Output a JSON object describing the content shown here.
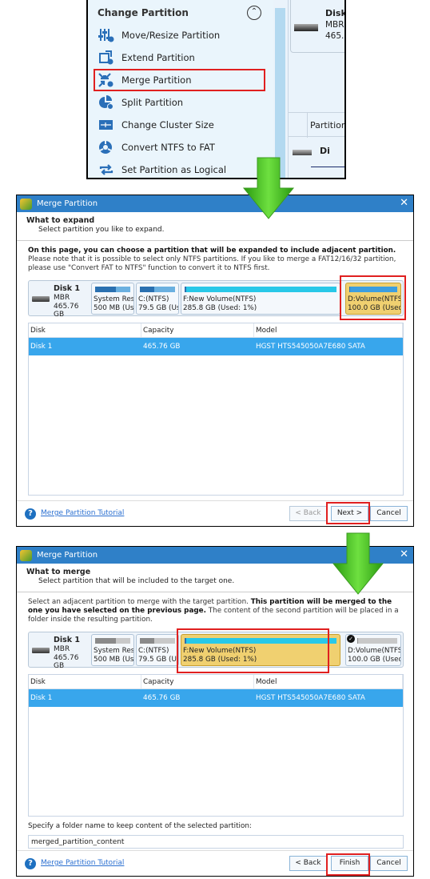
{
  "top_panel": {
    "group_title": "Change Partition",
    "collapse_icon": "chevron-up-circle-icon",
    "menu_items": [
      {
        "label": "Move/Resize Partition",
        "icon": "move-resize-icon"
      },
      {
        "label": "Extend Partition",
        "icon": "extend-icon"
      },
      {
        "label": "Merge Partition",
        "icon": "merge-icon",
        "highlighted": true
      },
      {
        "label": "Split Partition",
        "icon": "split-icon"
      },
      {
        "label": "Change Cluster Size",
        "icon": "cluster-icon"
      },
      {
        "label": "Convert NTFS to FAT",
        "icon": "convert-icon"
      },
      {
        "label": "Set Partition as Logical",
        "icon": "logical-icon"
      }
    ],
    "right_peek": {
      "disk_name": "Disk",
      "disk_type": "MBR",
      "disk_size": "465.",
      "column_header": "Partition",
      "disk_row": "Di"
    }
  },
  "dialog1": {
    "title": "Merge Partition",
    "header_title": "What to expand",
    "header_sub": "Select partition you like to expand.",
    "desc_bold": "On this page, you can choose a partition that will be expanded to include adjacent partition.",
    "desc_rest": " Please note that it is possible to select only NTFS partitions. If you like to merge a FAT12/16/32 partition, please use \"Convert FAT to NTFS\" function to convert it to NTFS first.",
    "disk": {
      "name": "Disk 1",
      "type": "MBR",
      "size": "465.76 GB"
    },
    "partitions": [
      {
        "l1": "System Rese",
        "l2": "500 MB (Use",
        "used": 0.6
      },
      {
        "l1": "C:(NTFS)",
        "l2": "79.5 GB (Us",
        "used": 0.4
      },
      {
        "l1": "F:New Volume(NTFS)",
        "l2": "285.8 GB (Used: 1%)",
        "used": 0.01
      },
      {
        "l1": "D:Volume(NTFS",
        "l2": "100.0 GB (Used",
        "used": 0.02,
        "selected": true
      }
    ],
    "table": {
      "headers": [
        "Disk",
        "Capacity",
        "Model"
      ],
      "rows": [
        [
          "Disk 1",
          "465.76 GB",
          "HGST HTS545050A7E680 SATA"
        ]
      ]
    },
    "tutorial_link": "Merge Partition Tutorial",
    "buttons": {
      "back": "< Back",
      "next": "Next >",
      "cancel": "Cancel"
    }
  },
  "dialog2": {
    "title": "Merge Partition",
    "header_title": "What to merge",
    "header_sub": "Select partition that will be included to the target one.",
    "desc_start": "Select an adjacent partition to merge with the target partition. ",
    "desc_bold": "This partition will be merged to the one you have selected on the previous page.",
    "desc_rest": " The content of the second partition will be placed in a folder inside the resulting partition.",
    "disk": {
      "name": "Disk 1",
      "type": "MBR",
      "size": "465.76 GB"
    },
    "partitions": [
      {
        "l1": "System Rese",
        "l2": "500 MB (Use",
        "used": 0.6
      },
      {
        "l1": "C:(NTFS)",
        "l2": "79.5 GB (Use",
        "used": 0.4
      },
      {
        "l1": "F:New Volume(NTFS)",
        "l2": "285.8 GB (Used: 1%)",
        "used": 0.01,
        "selected": true
      },
      {
        "l1": "D:Volume(NTFS",
        "l2": "100.0 GB (Used",
        "used": 0.02,
        "target": true
      }
    ],
    "table": {
      "headers": [
        "Disk",
        "Capacity",
        "Model"
      ],
      "rows": [
        [
          "Disk 1",
          "465.76 GB",
          "HGST HTS545050A7E680 SATA"
        ]
      ]
    },
    "folder_label": "Specify a folder name to keep content of the selected partition:",
    "folder_value": "merged_partition_content",
    "tutorial_link": "Merge Partition Tutorial",
    "buttons": {
      "back": "< Back",
      "finish": "Finish",
      "cancel": "Cancel"
    }
  },
  "colors": {
    "accent": "#2f80c8",
    "selected_row": "#38a6ec",
    "selected_partition": "#f0d070",
    "highlight_box": "#e02020",
    "arrow": "#3cbf1c"
  }
}
